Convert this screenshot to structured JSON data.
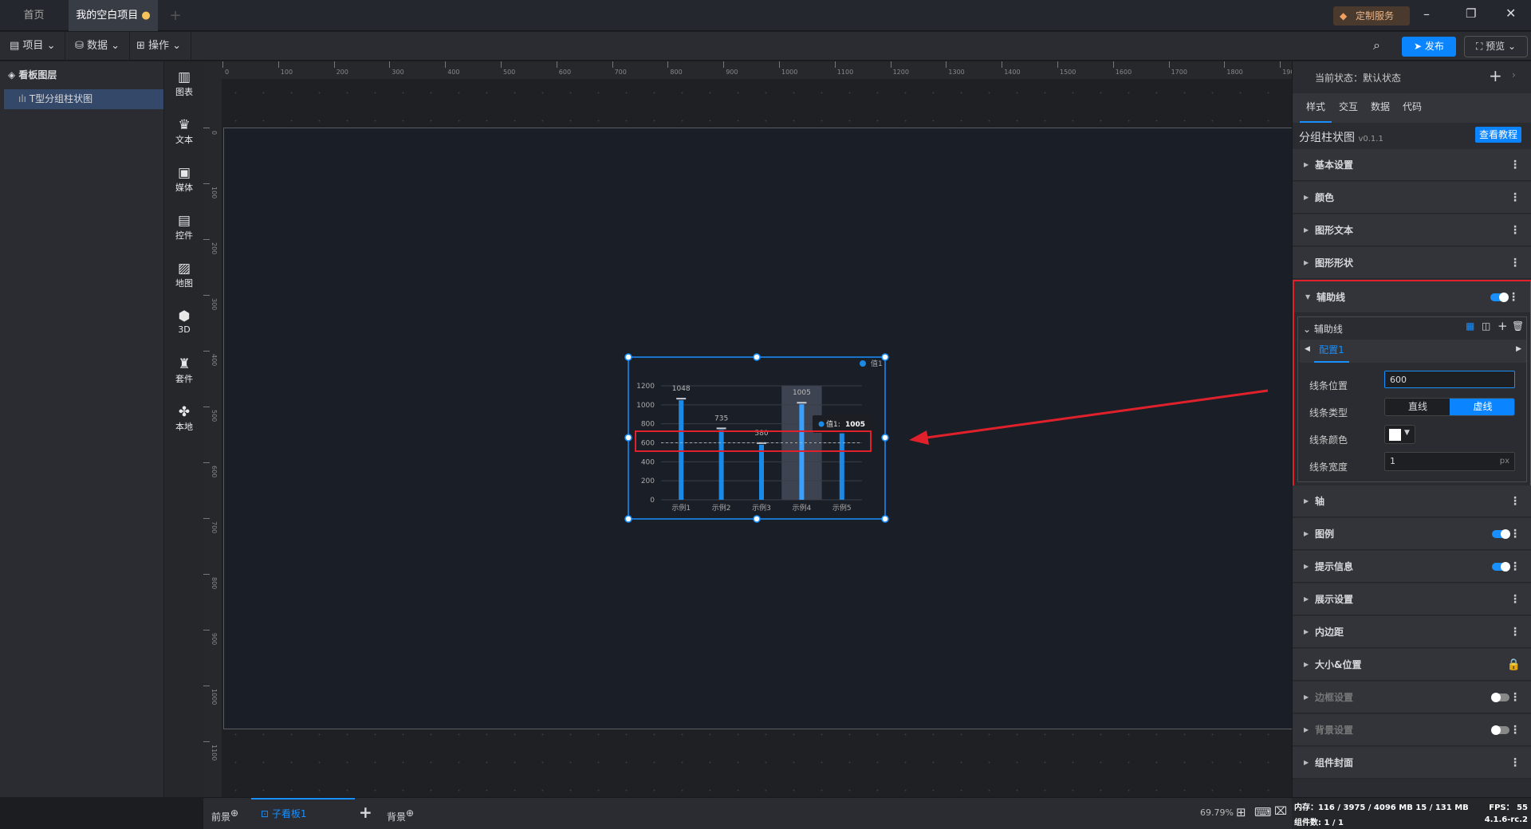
{
  "titlebar": {
    "tabs": [
      "首页",
      "我的空白项目"
    ],
    "add_tab": "+",
    "custom_service": "定制服务"
  },
  "toolbar": {
    "menus": [
      "项目",
      "数据",
      "操作"
    ],
    "publish": "发布",
    "preview": "预览"
  },
  "layers": {
    "title": "看板图层",
    "items": [
      "T型分组柱状图"
    ]
  },
  "components": [
    "图表",
    "文本",
    "媒体",
    "控件",
    "地图",
    "3D",
    "套件",
    "本地"
  ],
  "ruler": {
    "top": [
      0,
      100,
      200,
      300,
      400,
      500,
      600,
      700,
      800,
      900,
      1000,
      1100,
      1200,
      1300,
      1400,
      1500,
      1600,
      1700,
      1800,
      1900
    ],
    "left": [
      0,
      100,
      200,
      300,
      400,
      500,
      600,
      700,
      800,
      900,
      1000,
      1100
    ]
  },
  "bottom": {
    "foreground": "前景",
    "subboard": "子看板1",
    "add": "+",
    "background": "背景",
    "zoom": "69.79%"
  },
  "right": {
    "state_label": "当前状态：默认状态",
    "tabs": [
      "样式",
      "交互",
      "数据",
      "代码"
    ],
    "component_name": "分组柱状图",
    "version": "v0.1.1",
    "tutorial": "查看教程",
    "sections": [
      "基本设置",
      "颜色",
      "图形文本",
      "图形形状"
    ],
    "guide": {
      "title": "辅助线",
      "enabled": true,
      "sub_title": "辅助线",
      "config_tab": "配置1",
      "fields": {
        "position_label": "线条位置",
        "position_value": "600",
        "type_label": "线条类型",
        "type_options": [
          "直线",
          "虚线"
        ],
        "type_selected": "虚线",
        "color_label": "线条颜色",
        "color_value": "#ffffff",
        "width_label": "线条宽度",
        "width_value": "1",
        "width_unit": "px"
      }
    },
    "sections2": [
      {
        "label": "轴"
      },
      {
        "label": "图例",
        "toggle": true
      },
      {
        "label": "提示信息",
        "toggle": true
      },
      {
        "label": "展示设置"
      },
      {
        "label": "内边距"
      },
      {
        "label": "大小&位置",
        "lock": true
      },
      {
        "label": "边框设置",
        "toggle": false,
        "disabled": true
      },
      {
        "label": "背景设置",
        "toggle": false,
        "disabled": true
      },
      {
        "label": "组件封面"
      }
    ]
  },
  "status": {
    "memory": "内存：116 / 3975 / 4096 MB  15 / 131 MB",
    "fps": "FPS：  55",
    "count": "组件数: 1 / 1",
    "version": "4.1.6-rc.2"
  },
  "chart_data": {
    "type": "bar",
    "categories": [
      "示例1",
      "示例2",
      "示例3",
      "示例4",
      "示例5"
    ],
    "series": [
      {
        "name": "值1",
        "values": [
          1048,
          735,
          580,
          1005,
          700
        ]
      }
    ],
    "ylim": [
      0,
      1200
    ],
    "yticks": [
      0,
      200,
      400,
      600,
      800,
      1000,
      1200
    ],
    "grid": true,
    "legend": "top-right",
    "guide_line": {
      "value": 600,
      "style": "dashed"
    },
    "highlight_category": "示例4",
    "tooltip": {
      "label": "值1:",
      "value": "1005"
    },
    "color": "#1b8ae6"
  }
}
